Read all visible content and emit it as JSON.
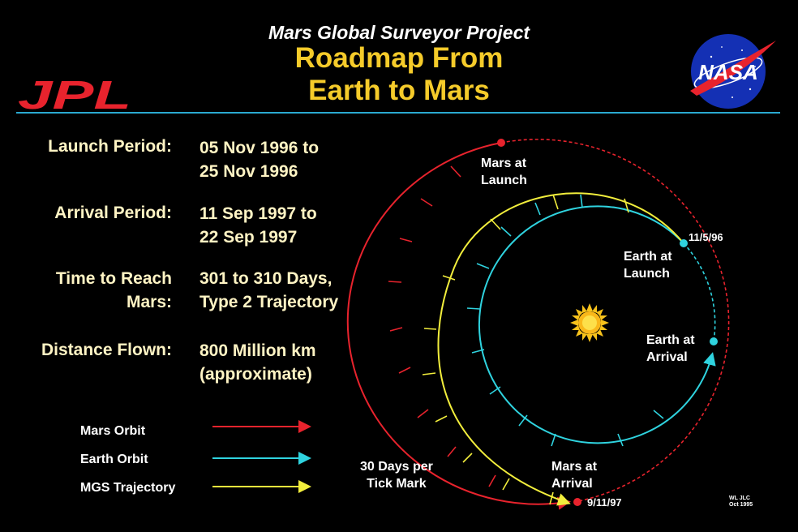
{
  "header": {
    "subtitle": "Mars Global Surveyor Project",
    "title_line1": "Roadmap From",
    "title_line2": "Earth to Mars",
    "left_logo": "JPL",
    "right_logo": "NASA"
  },
  "facts": [
    {
      "label": "Launch Period:",
      "value": "05 Nov 1996 to\n25 Nov 1996"
    },
    {
      "label": "Arrival Period:",
      "value": "11 Sep 1997 to\n22 Sep 1997"
    },
    {
      "label": "Time to Reach\nMars:",
      "value": "301 to 310 Days,\nType 2 Trajectory"
    },
    {
      "label": "Distance Flown:",
      "value": "800 Million km\n(approximate)"
    }
  ],
  "legend": [
    {
      "label": "Mars Orbit",
      "color": "#e8232d"
    },
    {
      "label": "Earth Orbit",
      "color": "#2fd3df"
    },
    {
      "label": "MGS Trajectory",
      "color": "#f2ee3c"
    }
  ],
  "diagram": {
    "mars_at_launch": "Mars at\nLaunch",
    "earth_at_launch": "Earth at\nLaunch",
    "earth_launch_date": "11/5/96",
    "earth_at_arrival": "Earth at\nArrival",
    "mars_at_arrival": "Mars at\nArrival",
    "mars_arrival_date": "9/11/97",
    "tick_note": "30 Days per\nTick Mark"
  },
  "credit": {
    "line1": "WL JLC",
    "line2": "Oct 1995"
  },
  "colors": {
    "mars": "#e8232d",
    "earth": "#2fd3df",
    "trajectory": "#f2ee3c",
    "title": "#f5cb2a",
    "sun": "#f7c21b",
    "rule": "#2aa9d0"
  }
}
